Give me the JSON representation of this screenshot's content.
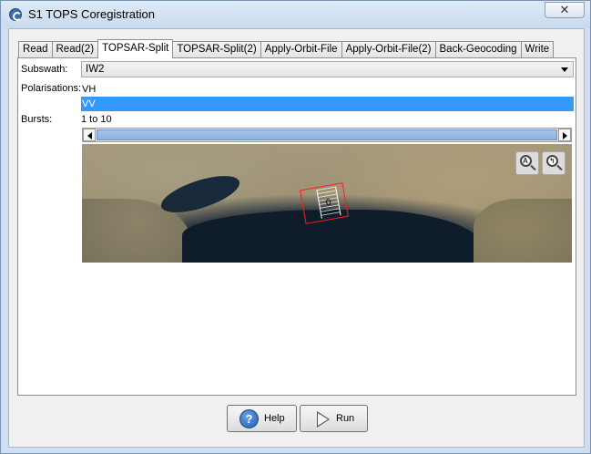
{
  "window": {
    "title": "S1 TOPS Coregistration",
    "close_glyph": "✕"
  },
  "tabs": [
    {
      "label": "Read"
    },
    {
      "label": "Read(2)"
    },
    {
      "label": "TOPSAR-Split",
      "active": true
    },
    {
      "label": "TOPSAR-Split(2)"
    },
    {
      "label": "Apply-Orbit-File"
    },
    {
      "label": "Apply-Orbit-File(2)"
    },
    {
      "label": "Back-Geocoding"
    },
    {
      "label": "Write"
    }
  ],
  "form": {
    "subswath_label": "Subswath:",
    "subswath_value": "IW2",
    "polarisations_label": "Polarisations:",
    "polarisations": [
      {
        "label": "VH",
        "selected": false
      },
      {
        "label": "VV",
        "selected": true
      }
    ],
    "bursts_label": "Bursts:",
    "bursts_value": "1 to 10"
  },
  "map": {
    "burst_label": "0",
    "zoom_all_glyph": "A",
    "zoom_prev_glyph": "↰"
  },
  "buttons": {
    "help_label": "Help",
    "help_glyph": "?",
    "run_label": "Run"
  },
  "colors": {
    "selection": "#3399ff",
    "burst_outline": "#ff1a1a"
  }
}
